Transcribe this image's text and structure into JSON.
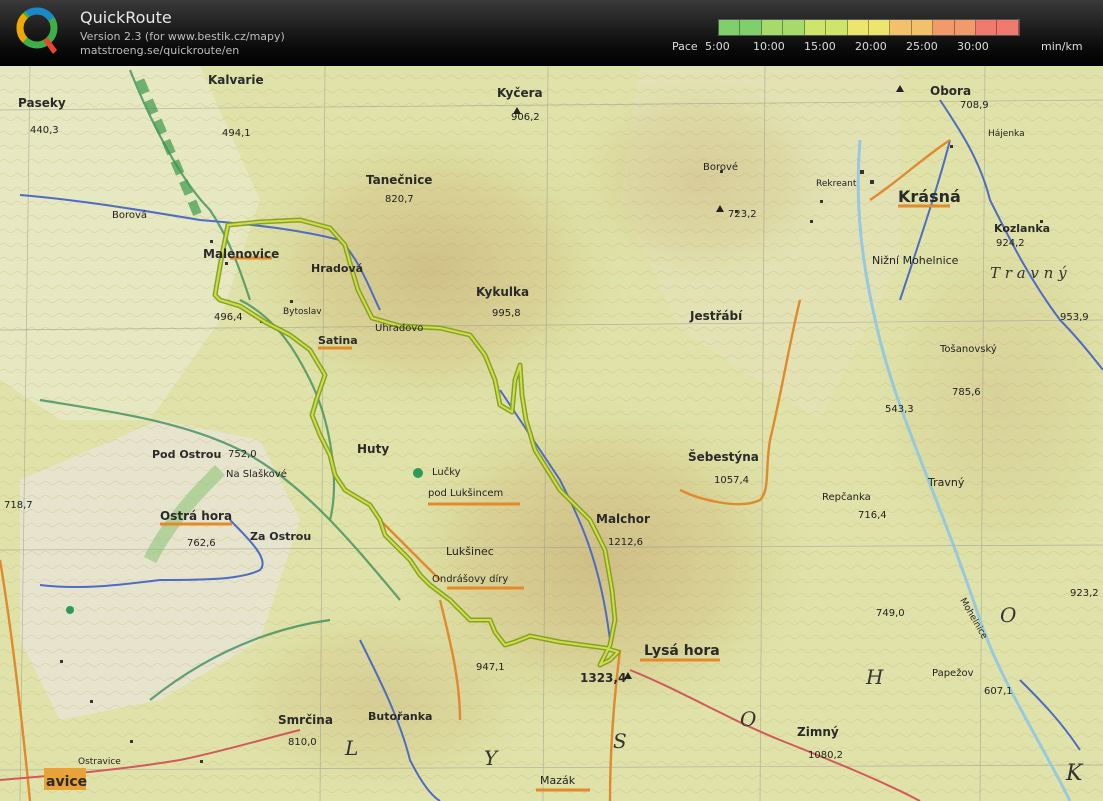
{
  "header": {
    "title": "QuickRoute",
    "version": "Version 2.3  (for www.bestik.cz/mapy)",
    "url": "matstroeng.se/quickroute/en",
    "pace_label": "Pace",
    "pace_ticks": [
      "5:00",
      "10:00",
      "15:00",
      "20:00",
      "25:00",
      "30:00"
    ],
    "unit": "min/km",
    "pace_colors": [
      "#7fcf6a",
      "#a6da6a",
      "#cfe46b",
      "#ede56e",
      "#f3c06c",
      "#f29a6a",
      "#ef7a6e"
    ]
  },
  "map": {
    "route_color": "#a8c832",
    "labels": {
      "kalvarie": "Kalvarie",
      "paseky": "Paseky",
      "paseky_elev": "440,3",
      "kalvarie_elev": "494,1",
      "kycera": "Kyčera",
      "kycera_elev": "906,2",
      "obora": "Obora",
      "obora_elev": "708,9",
      "hajenka": "Hájenka",
      "tanecnice": "Tanečnice",
      "tanecnice_elev": "820,7",
      "borove": "Borové",
      "borove_elev": "723,2",
      "rekreant": "Rekreant",
      "krasna": "Krásná",
      "kozlanka": "Kozlanka",
      "kozlanka_elev": "924,2",
      "nizni_mohelnice": "Nižní Mohelnice",
      "travny_big": "T r a v n ý",
      "borova": "Borová",
      "malenovice": "Malenovice",
      "hradova": "Hradová",
      "kykulka": "Kykulka",
      "kykulka_elev": "995,8",
      "jestrabi": "Jestřábí",
      "bytoslav": "Bytoslav",
      "satina": "Satina",
      "uhradovo": "Uhradovo",
      "elev_953": "953,9",
      "tosanovsky": "Tošanovský",
      "elev_785": "785,6",
      "elev_543": "543,3",
      "pod_ostrou": "Pod Ostrou",
      "na_slaskove": "Na Slaškové",
      "huty": "Huty",
      "lucky": "Lučky",
      "pod_luksincem": "pod Lukšincem",
      "sebestyna": "Šebestýna",
      "sebestyna_elev": "1057,4",
      "travny": "Travný",
      "repcanka": "Repčanka",
      "repcanka_elev": "716,4",
      "ostra_hora": "Ostrá hora",
      "ostra_hora_elev": "762,6",
      "za_ostrou": "Za Ostrou",
      "malchor": "Malchor",
      "malchor_elev": "1212,6",
      "luksinec": "Lukšinec",
      "ondrasovy_diry": "Ondrášovy díry",
      "elev_749": "749,0",
      "elev_923": "923,2",
      "o_letter": "O",
      "h_letter": "H",
      "lysa_hora": "Lysá hora",
      "lysa_hora_elev": "1323,4",
      "elev_947": "947,1",
      "papezov": "Papežov",
      "elev_607": "607,1",
      "mohelnice_river": "Mohelnice",
      "smrcina": "Smrčina",
      "smrcina_elev": "810,0",
      "butoranka": "Butořanka",
      "l_letter": "L",
      "y_letter": "Y",
      "s_letter": "S",
      "o2_letter": "O",
      "zimny": "Zimný",
      "zimny_elev": "1080,2",
      "k_letter": "K",
      "mazak": "Mazák",
      "ostravice": "Ostravice",
      "avice": "avice",
      "elev_496": "496,4",
      "elev_718": "718,7",
      "elev_752": "752,0"
    }
  }
}
